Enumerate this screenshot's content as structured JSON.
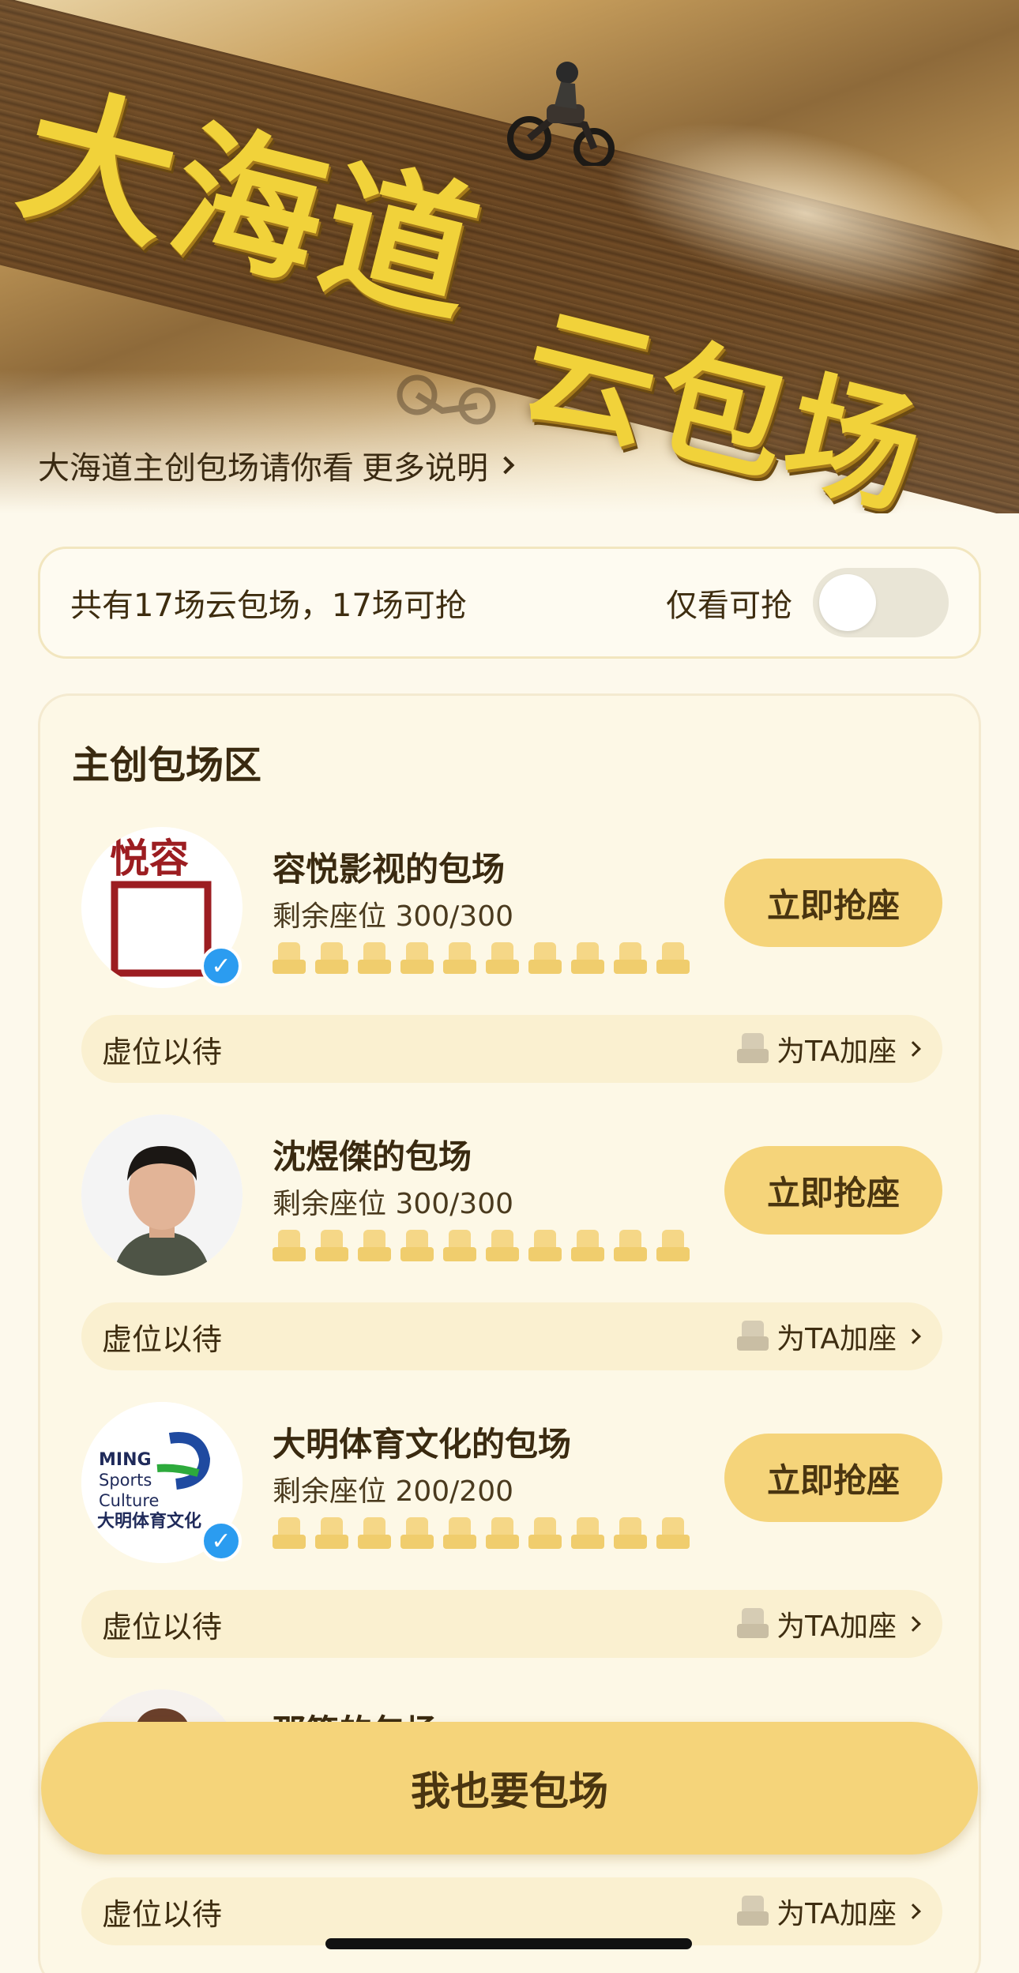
{
  "banner": {
    "title_line1": "大海道",
    "title_line2": "云包场",
    "subtitle": "大海道主创包场请你看",
    "more_link": "更多说明"
  },
  "summary": {
    "text": "共有17场云包场，17场可抢",
    "filter_label": "仅看可抢",
    "filter_on": false
  },
  "section": {
    "title": "主创包场区",
    "entries": [
      {
        "name": "容悦影视的包场",
        "seats": "剩余座位 300/300",
        "button": "立即抢座",
        "status": "虚位以待",
        "add_seat": "为TA加座",
        "avatar": "rongyue-logo",
        "verified": true
      },
      {
        "name": "沈煜傑的包场",
        "seats": "剩余座位 300/300",
        "button": "立即抢座",
        "status": "虚位以待",
        "add_seat": "为TA加座",
        "avatar": "person-photo",
        "verified": false
      },
      {
        "name": "大明体育文化的包场",
        "seats": "剩余座位 200/200",
        "button": "立即抢座",
        "status": "虚位以待",
        "add_seat": "为TA加座",
        "avatar": "ming-sports-logo",
        "logo_text": [
          "MING",
          "Sports",
          "Culture",
          "大明体育文化"
        ],
        "verified": true
      },
      {
        "name": "那笃的包场",
        "status": "虚位以待",
        "add_seat": "为TA加座",
        "avatar": "person-photo"
      }
    ]
  },
  "cta": {
    "label": "我也要包场"
  },
  "colors": {
    "accent": "#f5d47a",
    "background": "#fdf9ec",
    "verified": "#2b9cf0"
  }
}
